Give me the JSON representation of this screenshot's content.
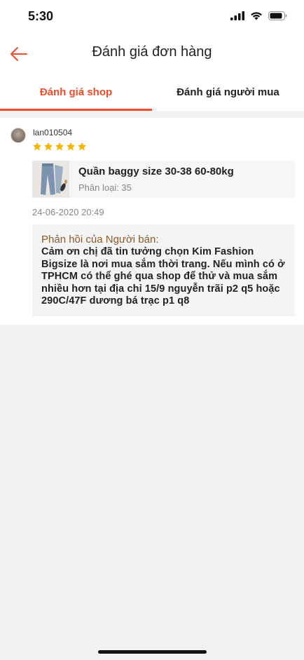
{
  "status": {
    "time": "5:30"
  },
  "header": {
    "title": "Đánh giá đơn hàng"
  },
  "tabs": [
    {
      "label": "Đánh giá shop",
      "active": true
    },
    {
      "label": "Đánh giá người mua",
      "active": false
    }
  ],
  "review": {
    "username": "lan010504",
    "rating": 5,
    "product": {
      "name": "Quần baggy size 30-38 60-80kg",
      "variant": "Phân loại: 35"
    },
    "date": "24-06-2020 20:49",
    "reply": {
      "title": "Phản hồi của Người bán:",
      "text": "Cảm ơn chị đã tin tưởng chọn Kim Fashion Bigsize là nơi mua sắm thời trang. Nếu mình có ở TPHCM có thể ghé qua shop để thử và mua sắm nhiều hơn tại địa chỉ 15/9 nguyễn trãi p2 q5 hoặc 290C/47F dương bá trạc p1 q8"
    }
  },
  "colors": {
    "accent": "#ee4d2d",
    "star": "#f7b500",
    "reply_title": "#8b5a2b"
  }
}
